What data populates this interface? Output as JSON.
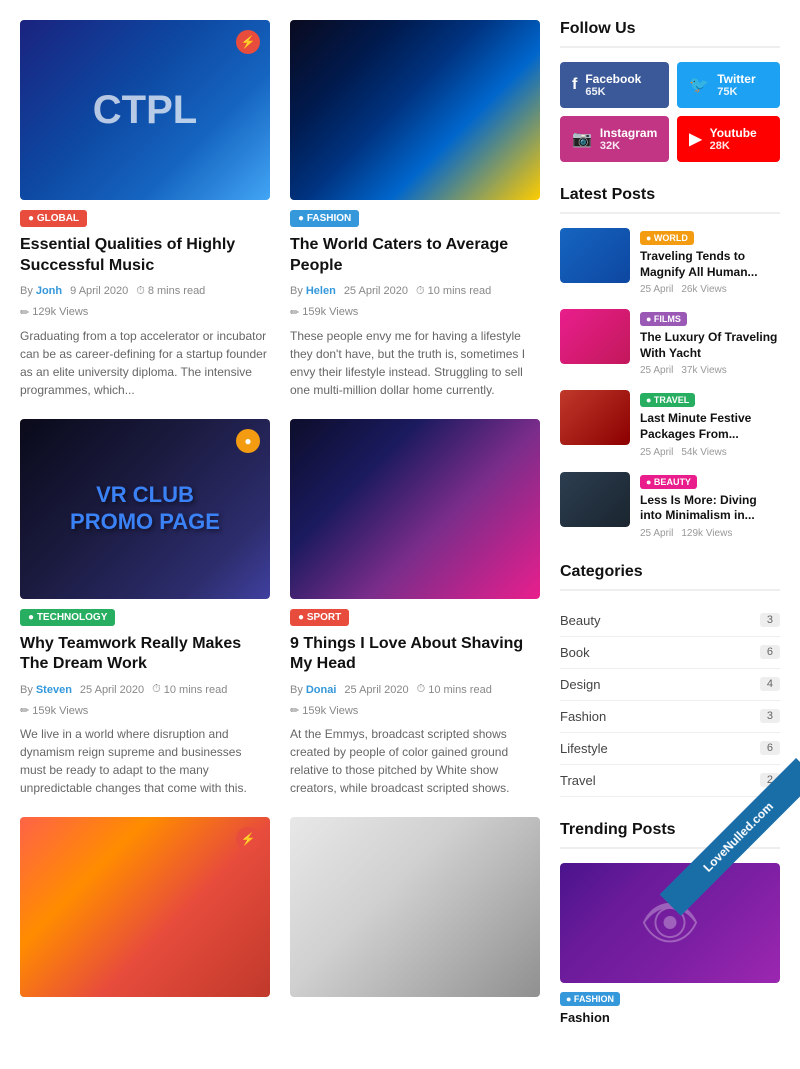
{
  "sidebar": {
    "follow_us_title": "Follow Us",
    "social": [
      {
        "id": "facebook",
        "name": "Facebook",
        "count": "65K",
        "class": "social-fb",
        "icon": "f"
      },
      {
        "id": "twitter",
        "name": "Twitter",
        "count": "75K",
        "class": "social-tw",
        "icon": "t"
      },
      {
        "id": "instagram",
        "name": "Instagram",
        "count": "32K",
        "class": "social-ig",
        "icon": "📷"
      },
      {
        "id": "youtube",
        "name": "Youtube",
        "count": "28K",
        "class": "social-yt",
        "icon": "▶"
      }
    ],
    "latest_posts_title": "Latest Posts",
    "latest_posts": [
      {
        "tag": "WORLD",
        "tag_class": "tag-world",
        "title": "Traveling Tends to Magnify All Human...",
        "date": "25 April",
        "views": "26k Views"
      },
      {
        "tag": "FILMS",
        "tag_class": "tag-films",
        "title": "The Luxury Of Traveling With Yacht",
        "date": "25 April",
        "views": "37k Views"
      },
      {
        "tag": "TRAVEL",
        "tag_class": "tag-travel",
        "title": "Last Minute Festive Packages From...",
        "date": "25 April",
        "views": "54k Views"
      },
      {
        "tag": "BEAUTY",
        "tag_class": "tag-beauty",
        "title": "Less Is More: Diving into Minimalism in...",
        "date": "25 April",
        "views": "129k Views"
      }
    ],
    "categories_title": "Categories",
    "categories": [
      {
        "name": "Beauty",
        "count": "3"
      },
      {
        "name": "Book",
        "count": "6"
      },
      {
        "name": "Design",
        "count": "4"
      },
      {
        "name": "Fashion",
        "count": "3"
      },
      {
        "name": "Lifestyle",
        "count": "6"
      },
      {
        "name": "Travel",
        "count": "2"
      }
    ],
    "trending_title": "Trending Posts"
  },
  "articles": [
    {
      "id": "article1",
      "tag": "GLOBAL",
      "tag_class": "tag-global",
      "badge": "⚡",
      "badge_class": "badge-red",
      "img_class": "img-adidas",
      "title": "Essential Qualities of Highly Successful Music",
      "author": "Jonh",
      "date": "9 April 2020",
      "read_time": "8 mins read",
      "views": "129k Views",
      "excerpt": "Graduating from a top accelerator or incubator can be as career-defining for a startup founder as an elite university diploma. The intensive programmes, which..."
    },
    {
      "id": "article2",
      "tag": "FASHION",
      "tag_class": "tag-fashion",
      "badge": "",
      "badge_class": "",
      "img_class": "img-fashion-girl",
      "title": "The World Caters to Average People",
      "author": "Helen",
      "date": "25 April 2020",
      "read_time": "10 mins read",
      "views": "159k Views",
      "excerpt": "These people envy me for having a lifestyle they don't have, but the truth is, sometimes I envy their lifestyle instead. Struggling to sell one multi-million dollar home currently."
    },
    {
      "id": "article3",
      "tag": "TECHNOLOGY",
      "tag_class": "tag-technology",
      "badge": "●",
      "badge_class": "badge-yellow",
      "img_class": "img-vr",
      "title": "Why Teamwork Really Makes The Dream Work",
      "author": "Steven",
      "date": "25 April 2020",
      "read_time": "10 mins read",
      "views": "159k Views",
      "excerpt": "We live in a world where disruption and dynamism reign supreme and businesses must be ready to adapt to the many unpredictable changes that come with this."
    },
    {
      "id": "article4",
      "tag": "SPORT",
      "tag_class": "tag-sport",
      "badge": "",
      "badge_class": "",
      "img_class": "img-shoe",
      "title": "9 Things I Love About Shaving My Head",
      "author": "Donai",
      "date": "25 April 2020",
      "read_time": "10 mins read",
      "views": "159k Views",
      "excerpt": "At the Emmys, broadcast scripted shows created by people of color gained ground relative to those pitched by White show creators, while broadcast scripted shows."
    },
    {
      "id": "article5",
      "tag": "",
      "tag_class": "",
      "badge": "⚡",
      "badge_class": "badge-red",
      "img_class": "img-couple",
      "title": "",
      "author": "",
      "date": "",
      "read_time": "",
      "views": "",
      "excerpt": ""
    },
    {
      "id": "article6",
      "tag": "",
      "tag_class": "",
      "badge": "",
      "badge_class": "",
      "img_class": "img-cartoon",
      "title": "",
      "author": "",
      "date": "",
      "read_time": "",
      "views": "",
      "excerpt": ""
    }
  ],
  "watermark": {
    "text": "LoveNulled.com"
  },
  "sidebar_fashion_label": "Fashion"
}
